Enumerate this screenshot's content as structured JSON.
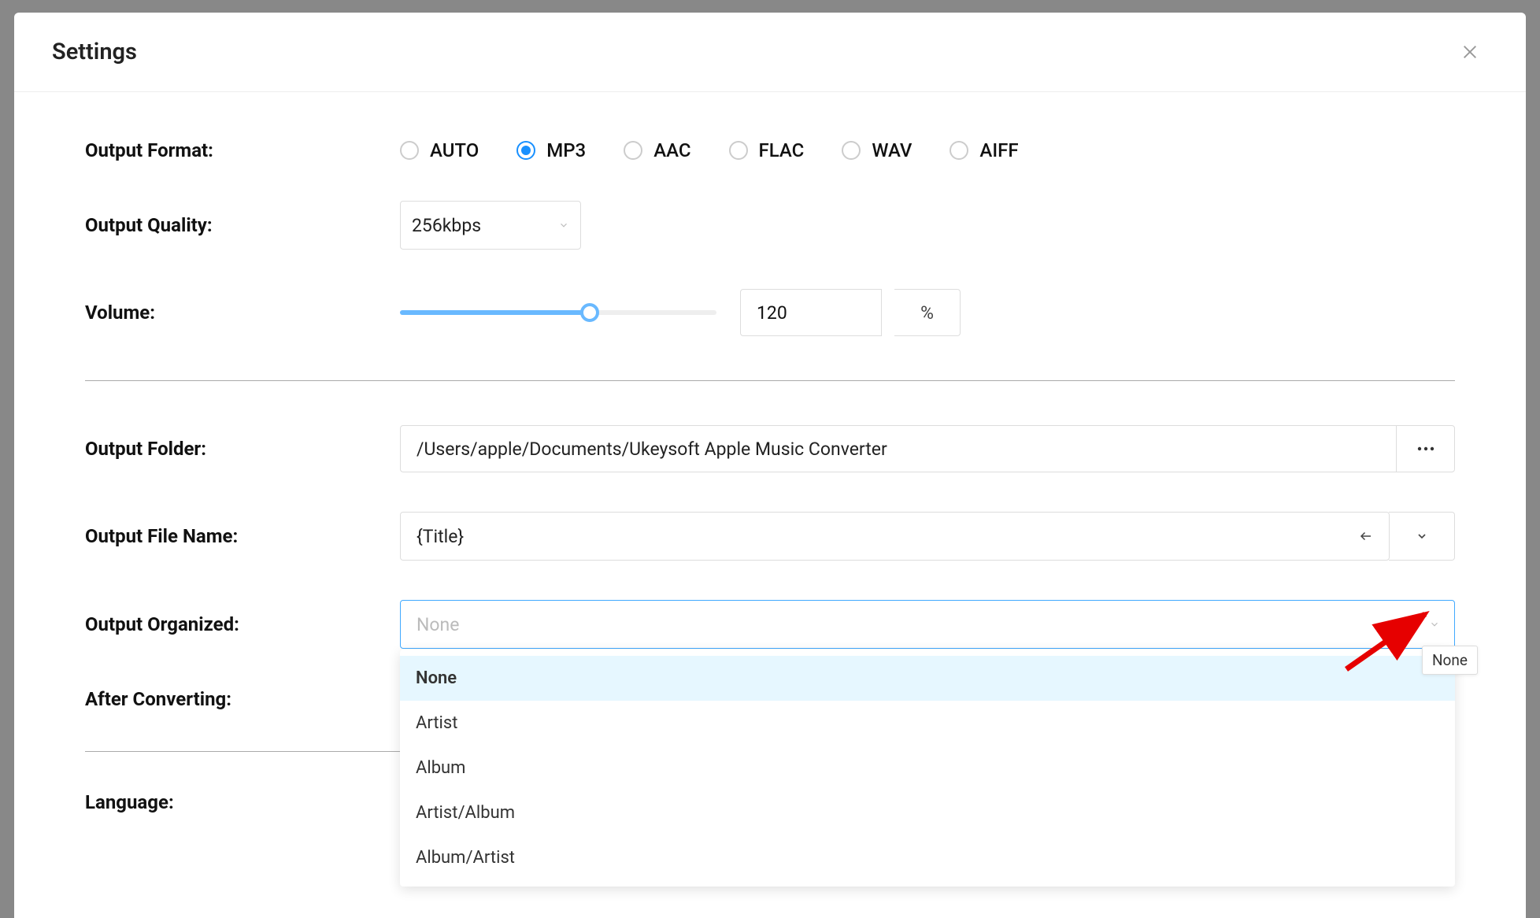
{
  "modal": {
    "title": "Settings"
  },
  "outputFormat": {
    "label": "Output Format:",
    "options": [
      "AUTO",
      "MP3",
      "AAC",
      "FLAC",
      "WAV",
      "AIFF"
    ],
    "selected": "MP3"
  },
  "outputQuality": {
    "label": "Output Quality:",
    "value": "256kbps"
  },
  "volume": {
    "label": "Volume:",
    "value": "120",
    "suffix": "%",
    "percent": 60
  },
  "outputFolder": {
    "label": "Output Folder:",
    "value": "/Users/apple/Documents/Ukeysoft Apple Music Converter"
  },
  "outputFileName": {
    "label": "Output File Name:",
    "value": "{Title}"
  },
  "outputOrganized": {
    "label": "Output Organized:",
    "placeholder": "None",
    "options": [
      "None",
      "Artist",
      "Album",
      "Artist/Album",
      "Album/Artist"
    ],
    "selectedIndex": 0,
    "tooltip": "None"
  },
  "afterConverting": {
    "label": "After Converting:"
  },
  "language": {
    "label": "Language:"
  }
}
